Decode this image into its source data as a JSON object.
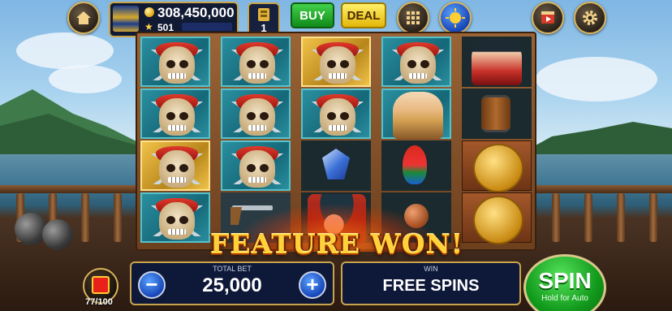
{
  "header": {
    "coins": "308,450,000",
    "level": "501",
    "stack_count": "1",
    "buy_label": "BUY",
    "deal_label": "DEAL"
  },
  "icons": {
    "home": "home-icon",
    "grid": "grid-menu-icon",
    "sun": "sun-bonus-icon",
    "video": "video-reward-icon",
    "settings": "gear-icon"
  },
  "reels": [
    [
      "pirate-skull",
      "pirate-skull",
      "pirate-skull",
      "pirate-skull"
    ],
    [
      "pirate-skull",
      "pirate-skull",
      "pirate-skull",
      "empty"
    ],
    [
      "pirate-skull",
      "pirate-skull",
      "blue-gem",
      "pirate-captain"
    ],
    [
      "pirate-skull",
      "pirate-lady",
      "parrot",
      "flintlock-pistol"
    ],
    [
      "pirate-lady-hat",
      "rum-barrel",
      "gold-skull-coin",
      "gold-skull-coin"
    ]
  ],
  "banner": "FEATURE WON!",
  "bet": {
    "caption": "TOTAL BET",
    "value": "25,000",
    "minus": "−",
    "plus": "+"
  },
  "win": {
    "caption": "WIN",
    "value": "FREE SPINS"
  },
  "spin": {
    "label": "SPIN",
    "sublabel": "Hold for Auto"
  },
  "gift": {
    "progress": "77/100"
  },
  "colors": {
    "accent_gold": "#c9a44d",
    "buy_green": "#1ea628",
    "deal_yellow": "#f2cc2a",
    "spin_green": "#129a1c",
    "panel_navy": "#0e1838"
  }
}
